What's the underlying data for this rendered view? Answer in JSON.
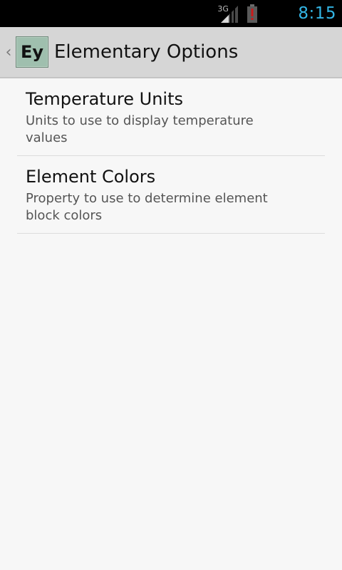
{
  "status_bar": {
    "network_label": "3G",
    "signal_icon": "signal-strength-icon",
    "battery_icon": "battery-alert-icon",
    "battery_alert_color": "#cc1a1a",
    "time": "8:15",
    "time_color": "#33b5e5"
  },
  "action_bar": {
    "back_icon": "chevron-left-icon",
    "app_icon_text": "Ey",
    "title": "Elementary Options"
  },
  "preferences": [
    {
      "title": "Temperature Units",
      "summary": "Units to use to display temperature values"
    },
    {
      "title": "Element Colors",
      "summary": "Property to use to determine element block colors"
    }
  ]
}
